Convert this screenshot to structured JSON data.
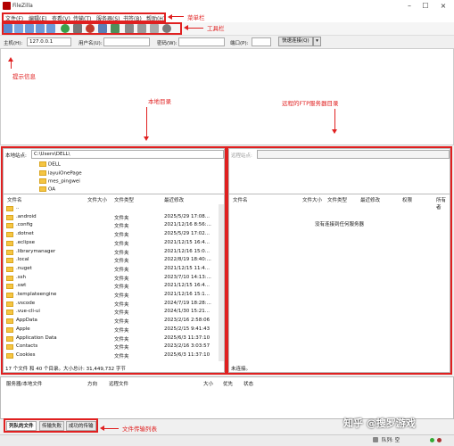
{
  "window": {
    "title": "FileZilla"
  },
  "menu": [
    "文件(F)",
    "编辑(E)",
    "查看(V)",
    "传输(T)",
    "服务器(S)",
    "书签(B)",
    "帮助(H)"
  ],
  "annotations": {
    "menubar": "菜单栏",
    "toolbar": "工具栏",
    "message": "提示信息",
    "local": "本地目录",
    "remote": "远程的FTP服务器目录",
    "queue": "文件传输列表"
  },
  "quickconnect": {
    "host_label": "主机(H):",
    "host_value": "127.0.0.1",
    "user_label": "用户名(U):",
    "pass_label": "密码(W):",
    "port_label": "端口(P):",
    "button": "快速连接(Q)"
  },
  "local": {
    "site_label": "本地站点:",
    "path": "C:\\Users\\DELL\\",
    "tree": [
      "DELL",
      "layuiOnePage",
      "mes_pingwei",
      "OA"
    ],
    "columns": [
      "文件名",
      "文件大小",
      "文件类型",
      "最近修改"
    ],
    "files": [
      {
        "name": "..",
        "type": "",
        "date": ""
      },
      {
        "name": ".android",
        "type": "文件夹",
        "date": "2025/5/29 17:08..."
      },
      {
        "name": ".config",
        "type": "文件夹",
        "date": "2021/12/16 8:56:..."
      },
      {
        "name": ".dotnet",
        "type": "文件夹",
        "date": "2025/5/29 17:02..."
      },
      {
        "name": ".eclipse",
        "type": "文件夹",
        "date": "2021/12/15 16:4..."
      },
      {
        "name": ".librarymanager",
        "type": "文件夹",
        "date": "2021/12/16 15:0..."
      },
      {
        "name": ".local",
        "type": "文件夹",
        "date": "2022/8/19 18:40:..."
      },
      {
        "name": ".nuget",
        "type": "文件夹",
        "date": "2021/12/15 11:4..."
      },
      {
        "name": ".ssh",
        "type": "文件夹",
        "date": "2023/7/10 14:13:..."
      },
      {
        "name": ".swt",
        "type": "文件夹",
        "date": "2021/12/15 16:4..."
      },
      {
        "name": ".templateengine",
        "type": "文件夹",
        "date": "2021/12/16 15:1..."
      },
      {
        "name": ".vscode",
        "type": "文件夹",
        "date": "2024/7/19 18:28:..."
      },
      {
        "name": ".vue-cli-ui",
        "type": "文件夹",
        "date": "2024/1/30 15:21..."
      },
      {
        "name": "AppData",
        "type": "文件夹",
        "date": "2023/2/16 2:58:06"
      },
      {
        "name": "Apple",
        "type": "文件夹",
        "date": "2025/2/15 9:41:43"
      },
      {
        "name": "Application Data",
        "type": "文件夹",
        "date": "2025/6/3 11:37:10"
      },
      {
        "name": "Contacts",
        "type": "文件夹",
        "date": "2023/2/16 3:03:57"
      },
      {
        "name": "Cookies",
        "type": "文件夹",
        "date": "2025/6/3 11:37:10"
      }
    ],
    "status": "17 个文件 和 40 个目录。大小总计: 31,449,732 字节"
  },
  "remote": {
    "site_label": "远程站点:",
    "columns": [
      "文件名",
      "文件大小",
      "文件类型",
      "最近修改",
      "权限",
      "所有者"
    ],
    "empty_msg": "没有连接到任何服务器",
    "status": "未连接。"
  },
  "queue": {
    "columns": [
      "服务器/本地文件",
      "方向",
      "远程文件",
      "大小",
      "优先",
      "状态"
    ],
    "tabs": [
      "列队的文件",
      "传输失败",
      "成功的传输"
    ],
    "status": "队列: 空"
  },
  "watermark": "知乎 @搜罗游戏",
  "colors": {
    "annotation": "#e02020",
    "folder": "#f5c542"
  }
}
